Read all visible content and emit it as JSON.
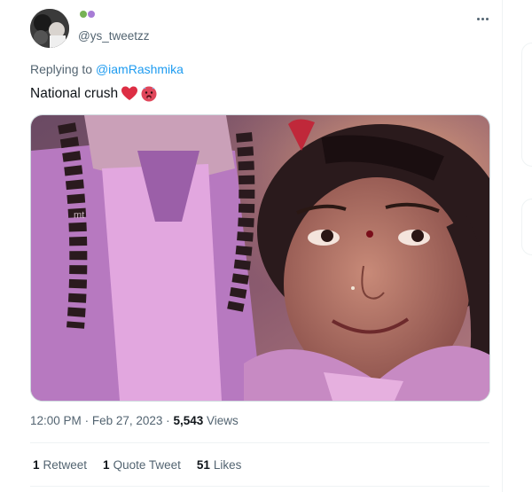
{
  "author": {
    "handle": "@ys_tweetzz"
  },
  "tweet": {
    "replying_prefix": "Replying to",
    "replying_to": "@iamRashmika",
    "text": "National crush",
    "emojis": [
      "red-heart",
      "hot-face"
    ]
  },
  "meta": {
    "time": "12:00 PM",
    "separator": "·",
    "date": "Feb 27, 2023",
    "views_count": "5,543",
    "views_label": "Views"
  },
  "stats": {
    "retweets_count": "1",
    "retweets_label": "Retweet",
    "quotes_count": "1",
    "quotes_label": "Quote Tweet",
    "likes_count": "51",
    "likes_label": "Likes"
  },
  "media": {
    "watermark": "mt"
  },
  "colors": {
    "link": "#1d9bf0",
    "secondary_text": "#536471",
    "primary_text": "#0f1419"
  }
}
